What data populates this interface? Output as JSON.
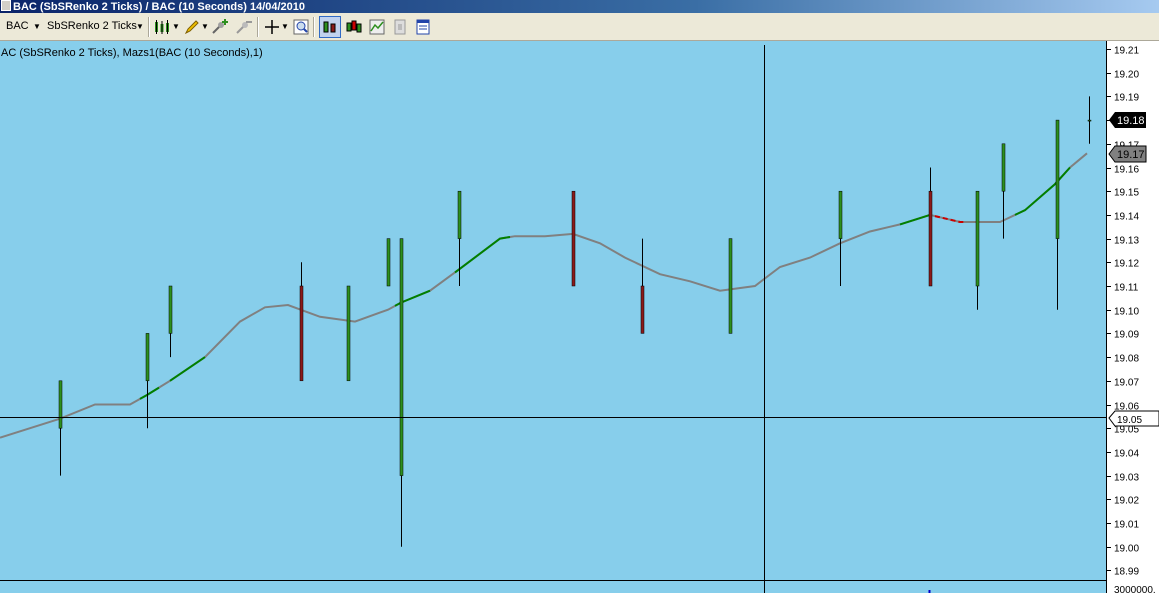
{
  "window": {
    "title": "BAC (SbSRenko 2 Ticks) / BAC (10 Seconds)  14/04/2010"
  },
  "toolbar": {
    "symbol": "BAC",
    "bar_type": "SbSRenko 2 Ticks",
    "icons": [
      "candlestick-chart-icon",
      "pencil-icon",
      "add-indicator-icon",
      "remove-indicator-icon",
      "crosshair-icon",
      "zoom-icon",
      "bar-chart-icon",
      "candle-chart-icon",
      "line-chart-icon",
      "template-icon",
      "properties-icon"
    ]
  },
  "chart": {
    "label": "AC (SbSRenko 2 Ticks), Mazs1(BAC (10 Seconds),1)",
    "volume_label": "3000000.",
    "current_price": "19.18",
    "ma_price": "19.17",
    "crosshair_price": "19.05",
    "colors": {
      "background": "#87ceeb",
      "up": "#2d8f1e",
      "down": "#8b1a1a",
      "ma": "#808080",
      "ma_up": "#008000",
      "ma_down": "#cc0000"
    }
  },
  "chart_data": {
    "type": "candlestick",
    "y_ticks": [
      "19.21",
      "19.20",
      "19.19",
      "19.18",
      "19.17",
      "19.16",
      "19.15",
      "19.14",
      "19.13",
      "19.12",
      "19.11",
      "19.10",
      "19.09",
      "19.08",
      "19.07",
      "19.06",
      "19.05",
      "19.04",
      "19.03",
      "19.02",
      "19.01",
      "19.00",
      "18.99"
    ],
    "ylim": [
      18.99,
      19.21
    ],
    "bars": [
      {
        "x": 60,
        "open": 19.05,
        "close": 19.07,
        "high": 19.07,
        "low": 19.03
      },
      {
        "x": 147,
        "open": 19.07,
        "close": 19.09,
        "high": 19.09,
        "low": 19.05
      },
      {
        "x": 170,
        "open": 19.09,
        "close": 19.11,
        "high": 19.11,
        "low": 19.08
      },
      {
        "x": 301,
        "open": 19.11,
        "close": 19.07,
        "high": 19.12,
        "low": 19.07
      },
      {
        "x": 348,
        "open": 19.07,
        "close": 19.11,
        "high": 19.11,
        "low": 19.07
      },
      {
        "x": 388,
        "open": 19.11,
        "close": 19.13,
        "high": 19.13,
        "low": 19.11
      },
      {
        "x": 401,
        "open": 19.03,
        "close": 19.13,
        "high": 19.13,
        "low": 19.0
      },
      {
        "x": 459,
        "open": 19.13,
        "close": 19.15,
        "high": 19.15,
        "low": 19.11
      },
      {
        "x": 573,
        "open": 19.15,
        "close": 19.11,
        "high": 19.15,
        "low": 19.11
      },
      {
        "x": 642,
        "open": 19.11,
        "close": 19.09,
        "high": 19.13,
        "low": 19.09
      },
      {
        "x": 730,
        "open": 19.09,
        "close": 19.13,
        "high": 19.13,
        "low": 19.09
      },
      {
        "x": 840,
        "open": 19.13,
        "close": 19.15,
        "high": 19.15,
        "low": 19.11
      },
      {
        "x": 930,
        "open": 19.15,
        "close": 19.11,
        "high": 19.16,
        "low": 19.11
      },
      {
        "x": 977,
        "open": 19.11,
        "close": 19.15,
        "high": 19.15,
        "low": 19.1
      },
      {
        "x": 1003,
        "open": 19.15,
        "close": 19.17,
        "high": 19.17,
        "low": 19.13
      },
      {
        "x": 1057,
        "open": 19.13,
        "close": 19.18,
        "high": 19.18,
        "low": 19.1
      },
      {
        "x": 1089,
        "open": 19.18,
        "close": 19.18,
        "high": 19.19,
        "low": 19.17
      }
    ],
    "ma": [
      [
        0,
        19.046
      ],
      [
        30,
        19.05
      ],
      [
        60,
        19.054
      ],
      [
        95,
        19.06
      ],
      [
        130,
        19.06
      ],
      [
        147,
        19.064
      ],
      [
        170,
        19.07
      ],
      [
        205,
        19.08
      ],
      [
        240,
        19.095
      ],
      [
        265,
        19.101
      ],
      [
        288,
        19.102
      ],
      [
        320,
        19.097
      ],
      [
        355,
        19.095
      ],
      [
        388,
        19.1
      ],
      [
        401,
        19.103
      ],
      [
        430,
        19.108
      ],
      [
        459,
        19.117
      ],
      [
        500,
        19.13
      ],
      [
        515,
        19.131
      ],
      [
        545,
        19.131
      ],
      [
        573,
        19.132
      ],
      [
        600,
        19.128
      ],
      [
        625,
        19.122
      ],
      [
        660,
        19.115
      ],
      [
        690,
        19.112
      ],
      [
        720,
        19.108
      ],
      [
        755,
        19.11
      ],
      [
        780,
        19.118
      ],
      [
        810,
        19.122
      ],
      [
        840,
        19.128
      ],
      [
        870,
        19.133
      ],
      [
        900,
        19.136
      ],
      [
        930,
        19.14
      ],
      [
        960,
        19.137
      ],
      [
        1000,
        19.137
      ],
      [
        1025,
        19.142
      ],
      [
        1055,
        19.153
      ],
      [
        1070,
        19.16
      ],
      [
        1087,
        19.166
      ]
    ],
    "ma_green": [
      [
        140,
        159
      ],
      [
        170,
        205
      ],
      [
        395,
        430
      ],
      [
        455,
        510
      ],
      [
        900,
        930
      ],
      [
        1015,
        1070
      ]
    ],
    "ma_red": [
      [
        935,
        965
      ]
    ]
  }
}
